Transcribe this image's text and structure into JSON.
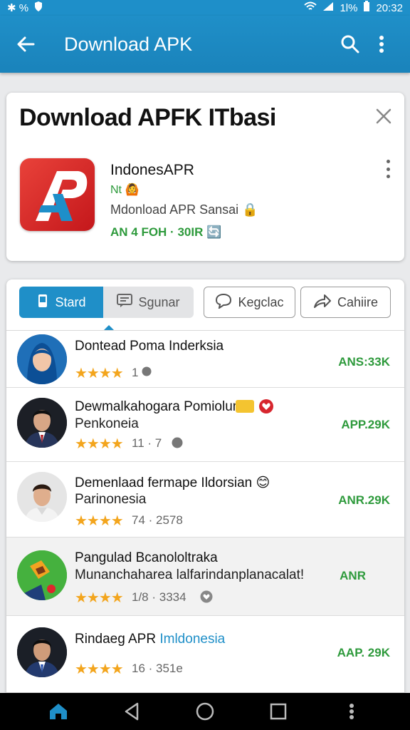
{
  "status_bar": {
    "left_text": "✱ %",
    "battery_text": "1l%",
    "time": "20:32"
  },
  "app_bar": {
    "title": "Download APK"
  },
  "header_card": {
    "heading": "Download  APFK ITbasi",
    "app_name": "IndonesAPR",
    "badge": "Nt 🙆",
    "subtitle": "Mdonload APR Sansai 🔒",
    "meta": "AN 4 FOH · 30IR 🔄"
  },
  "tabs": [
    {
      "label": "Stard",
      "icon": "phone-icon"
    },
    {
      "label": "Sgunar",
      "icon": "message-icon"
    },
    {
      "label": "Kegclac",
      "icon": "chat-bubble-icon"
    },
    {
      "label": "Cahiire",
      "icon": "share-icon"
    }
  ],
  "list": [
    {
      "name": "Dontead Poma Inderksia",
      "name2": "",
      "stars": "★★★★",
      "count": "1",
      "price": "ANS:33K"
    },
    {
      "name": "Dewmalkahogara Pomiolum",
      "name2": "Penkoneia",
      "stars": "★★★★",
      "count": "11 · 7",
      "price": "APP.29K"
    },
    {
      "name": "Demenlaad fermape Ildorsian 😊",
      "name2": "Parinonesia",
      "stars": "★★★★",
      "count": "74 · 2578",
      "price": "ANR.29K"
    },
    {
      "name": "Pangulad Bcanololtraka",
      "name2": "Munanchaharea lalfarindanplanacalat!",
      "stars": "★★★★",
      "count": "1/8 · 3334",
      "price": "ANR"
    },
    {
      "name": "Rindaeg APR",
      "name_blue": "Imldonesia",
      "name2": "",
      "stars": "★★★★",
      "count": "16 · 351e",
      "price": "AAP. 29K"
    }
  ],
  "colors": {
    "accent": "#1f8fc8",
    "price_green": "#2e9a3c",
    "star": "#f3a51d"
  }
}
